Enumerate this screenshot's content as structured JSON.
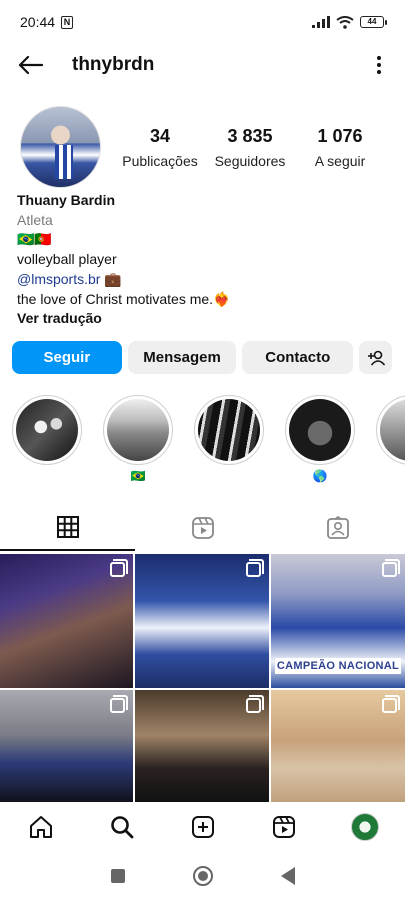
{
  "status_bar": {
    "time": "20:44",
    "nfc": "N",
    "battery": "44"
  },
  "header": {
    "username": "thnybrdn"
  },
  "stats": [
    {
      "value": "34",
      "label": "Publicações"
    },
    {
      "value": "3 835",
      "label": "Seguidores"
    },
    {
      "value": "1 076",
      "label": "A seguir"
    }
  ],
  "bio": {
    "name": "Thuany Bardin",
    "category": "Atleta",
    "flags": "🇧🇷🇵🇹",
    "line1": "volleyball player",
    "link": "@lmsports.br",
    "link_suffix": " 💼",
    "line3": "the love of Christ motivates me.❤️‍🔥",
    "translate": "Ver tradução"
  },
  "actions": {
    "follow": "Seguir",
    "message": "Mensagem",
    "contact": "Contacto"
  },
  "highlights": [
    {
      "label": ""
    },
    {
      "label": "🇧🇷"
    },
    {
      "label": ""
    },
    {
      "label": "🌎"
    },
    {
      "label": ""
    }
  ],
  "grid": {
    "post3_banner": "CAMPEÃO NACIONAL"
  },
  "colors": {
    "primary": "#0095f6",
    "button_grey": "#efefef",
    "link": "#1e3d8f"
  }
}
